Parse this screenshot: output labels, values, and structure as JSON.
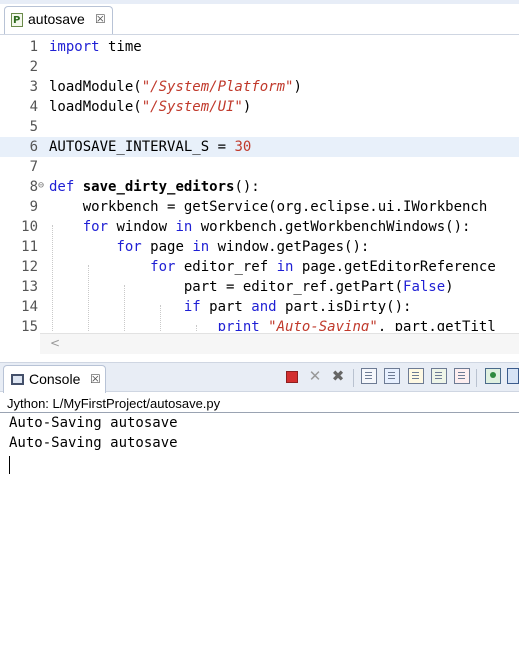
{
  "editor": {
    "tab": {
      "label": "autosave",
      "icon": "python-file-icon",
      "close": "☒"
    },
    "lines": [
      {
        "n": "1",
        "tokens": [
          [
            "kw",
            "import"
          ],
          [
            "",
            " time"
          ]
        ]
      },
      {
        "n": "2",
        "tokens": []
      },
      {
        "n": "3",
        "tokens": [
          [
            "",
            "loadModule("
          ],
          [
            "str",
            "\"/System/Platform\""
          ],
          [
            "",
            ")"
          ]
        ]
      },
      {
        "n": "4",
        "tokens": [
          [
            "",
            "loadModule("
          ],
          [
            "str",
            "\"/System/UI\""
          ],
          [
            "",
            ")"
          ]
        ]
      },
      {
        "n": "5",
        "tokens": []
      },
      {
        "n": "6",
        "highlight": true,
        "tokens": [
          [
            "",
            "AUTOSAVE_INTERVAL_S = "
          ],
          [
            "num",
            "30"
          ]
        ]
      },
      {
        "n": "7",
        "tokens": []
      },
      {
        "n": "8",
        "fold": true,
        "tokens": [
          [
            "kw",
            "def"
          ],
          [
            "",
            " "
          ],
          [
            "bold",
            "save_dirty_editors"
          ],
          [
            "",
            "():"
          ]
        ]
      },
      {
        "n": "9",
        "tokens": [
          [
            "",
            "    workbench = getService(org.eclipse.ui.IWorkbench"
          ]
        ]
      },
      {
        "n": "10",
        "tokens": [
          [
            "",
            "    "
          ],
          [
            "kw",
            "for"
          ],
          [
            "",
            " window "
          ],
          [
            "kw",
            "in"
          ],
          [
            "",
            " workbench.getWorkbenchWindows():"
          ]
        ]
      },
      {
        "n": "11",
        "tokens": [
          [
            "",
            "        "
          ],
          [
            "kw",
            "for"
          ],
          [
            "",
            " page "
          ],
          [
            "kw",
            "in"
          ],
          [
            "",
            " window.getPages():"
          ]
        ]
      },
      {
        "n": "12",
        "tokens": [
          [
            "",
            "            "
          ],
          [
            "kw",
            "for"
          ],
          [
            "",
            " editor_ref "
          ],
          [
            "kw",
            "in"
          ],
          [
            "",
            " page.getEditorReference"
          ]
        ]
      },
      {
        "n": "13",
        "tokens": [
          [
            "",
            "                part = editor_ref.getPart("
          ],
          [
            "kw",
            "False"
          ],
          [
            "",
            ")"
          ]
        ]
      },
      {
        "n": "14",
        "tokens": [
          [
            "",
            "                "
          ],
          [
            "kw",
            "if"
          ],
          [
            "",
            " part "
          ],
          [
            "kw",
            "and"
          ],
          [
            "",
            " part.isDirty():"
          ]
        ]
      },
      {
        "n": "15",
        "tokens": [
          [
            "",
            "                    "
          ],
          [
            "kw",
            "print"
          ],
          [
            "",
            " "
          ],
          [
            "str",
            "\"Auto-Saving\""
          ],
          [
            "",
            ", part.getTitl"
          ]
        ]
      }
    ],
    "scroll_left_arrow": "<"
  },
  "console": {
    "tab": {
      "label": "Console",
      "icon": "console-icon",
      "close": "☒"
    },
    "toolbar": [
      "terminate-icon",
      "remove-launch-icon",
      "remove-all-terminated-icon",
      "scroll-lock-icon",
      "show-console-stdout-icon",
      "show-console-stderr-icon",
      "word-wrap-icon",
      "clear-console-icon",
      "pin-console-icon",
      "open-console-icon"
    ],
    "path": "Jython: L/MyFirstProject/autosave.py",
    "output": [
      "Auto-Saving autosave",
      "Auto-Saving autosave"
    ]
  }
}
